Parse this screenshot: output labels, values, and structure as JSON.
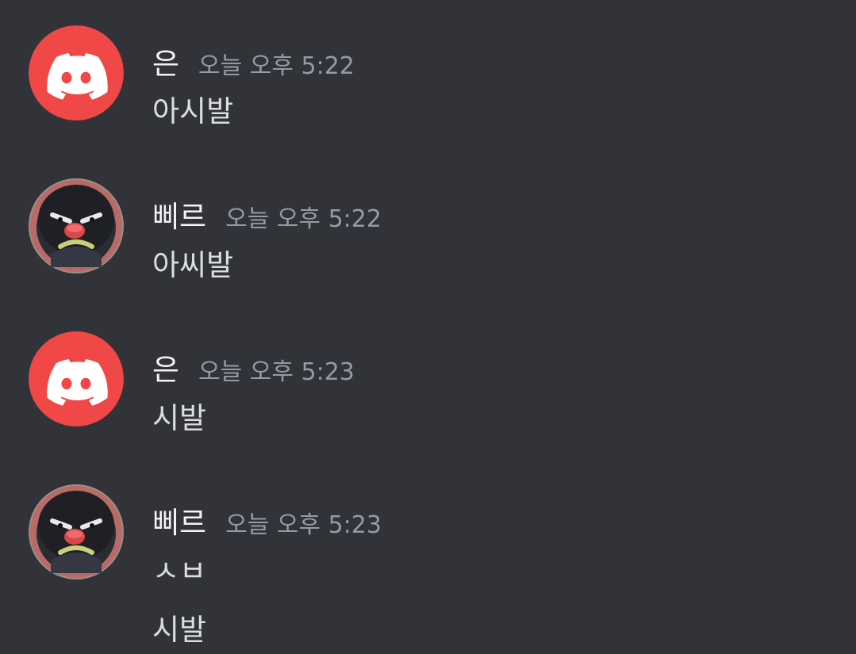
{
  "messages": [
    {
      "username": "은",
      "timestamp": "오늘 오후 5:22",
      "avatar": "discord-logo-icon",
      "avatar_color": "#f04747",
      "lines": [
        "아시발"
      ]
    },
    {
      "username": "삐르",
      "timestamp": "오늘 오후 5:22",
      "avatar": "angry-penguin-icon",
      "lines": [
        "아씨발"
      ]
    },
    {
      "username": "은",
      "timestamp": "오늘 오후 5:23",
      "avatar": "discord-logo-icon",
      "avatar_color": "#f04747",
      "lines": [
        "시발"
      ]
    },
    {
      "username": "삐르",
      "timestamp": "오늘 오후 5:23",
      "avatar": "angry-penguin-icon",
      "lines": [
        "ㅅㅂ",
        "시발"
      ]
    }
  ]
}
